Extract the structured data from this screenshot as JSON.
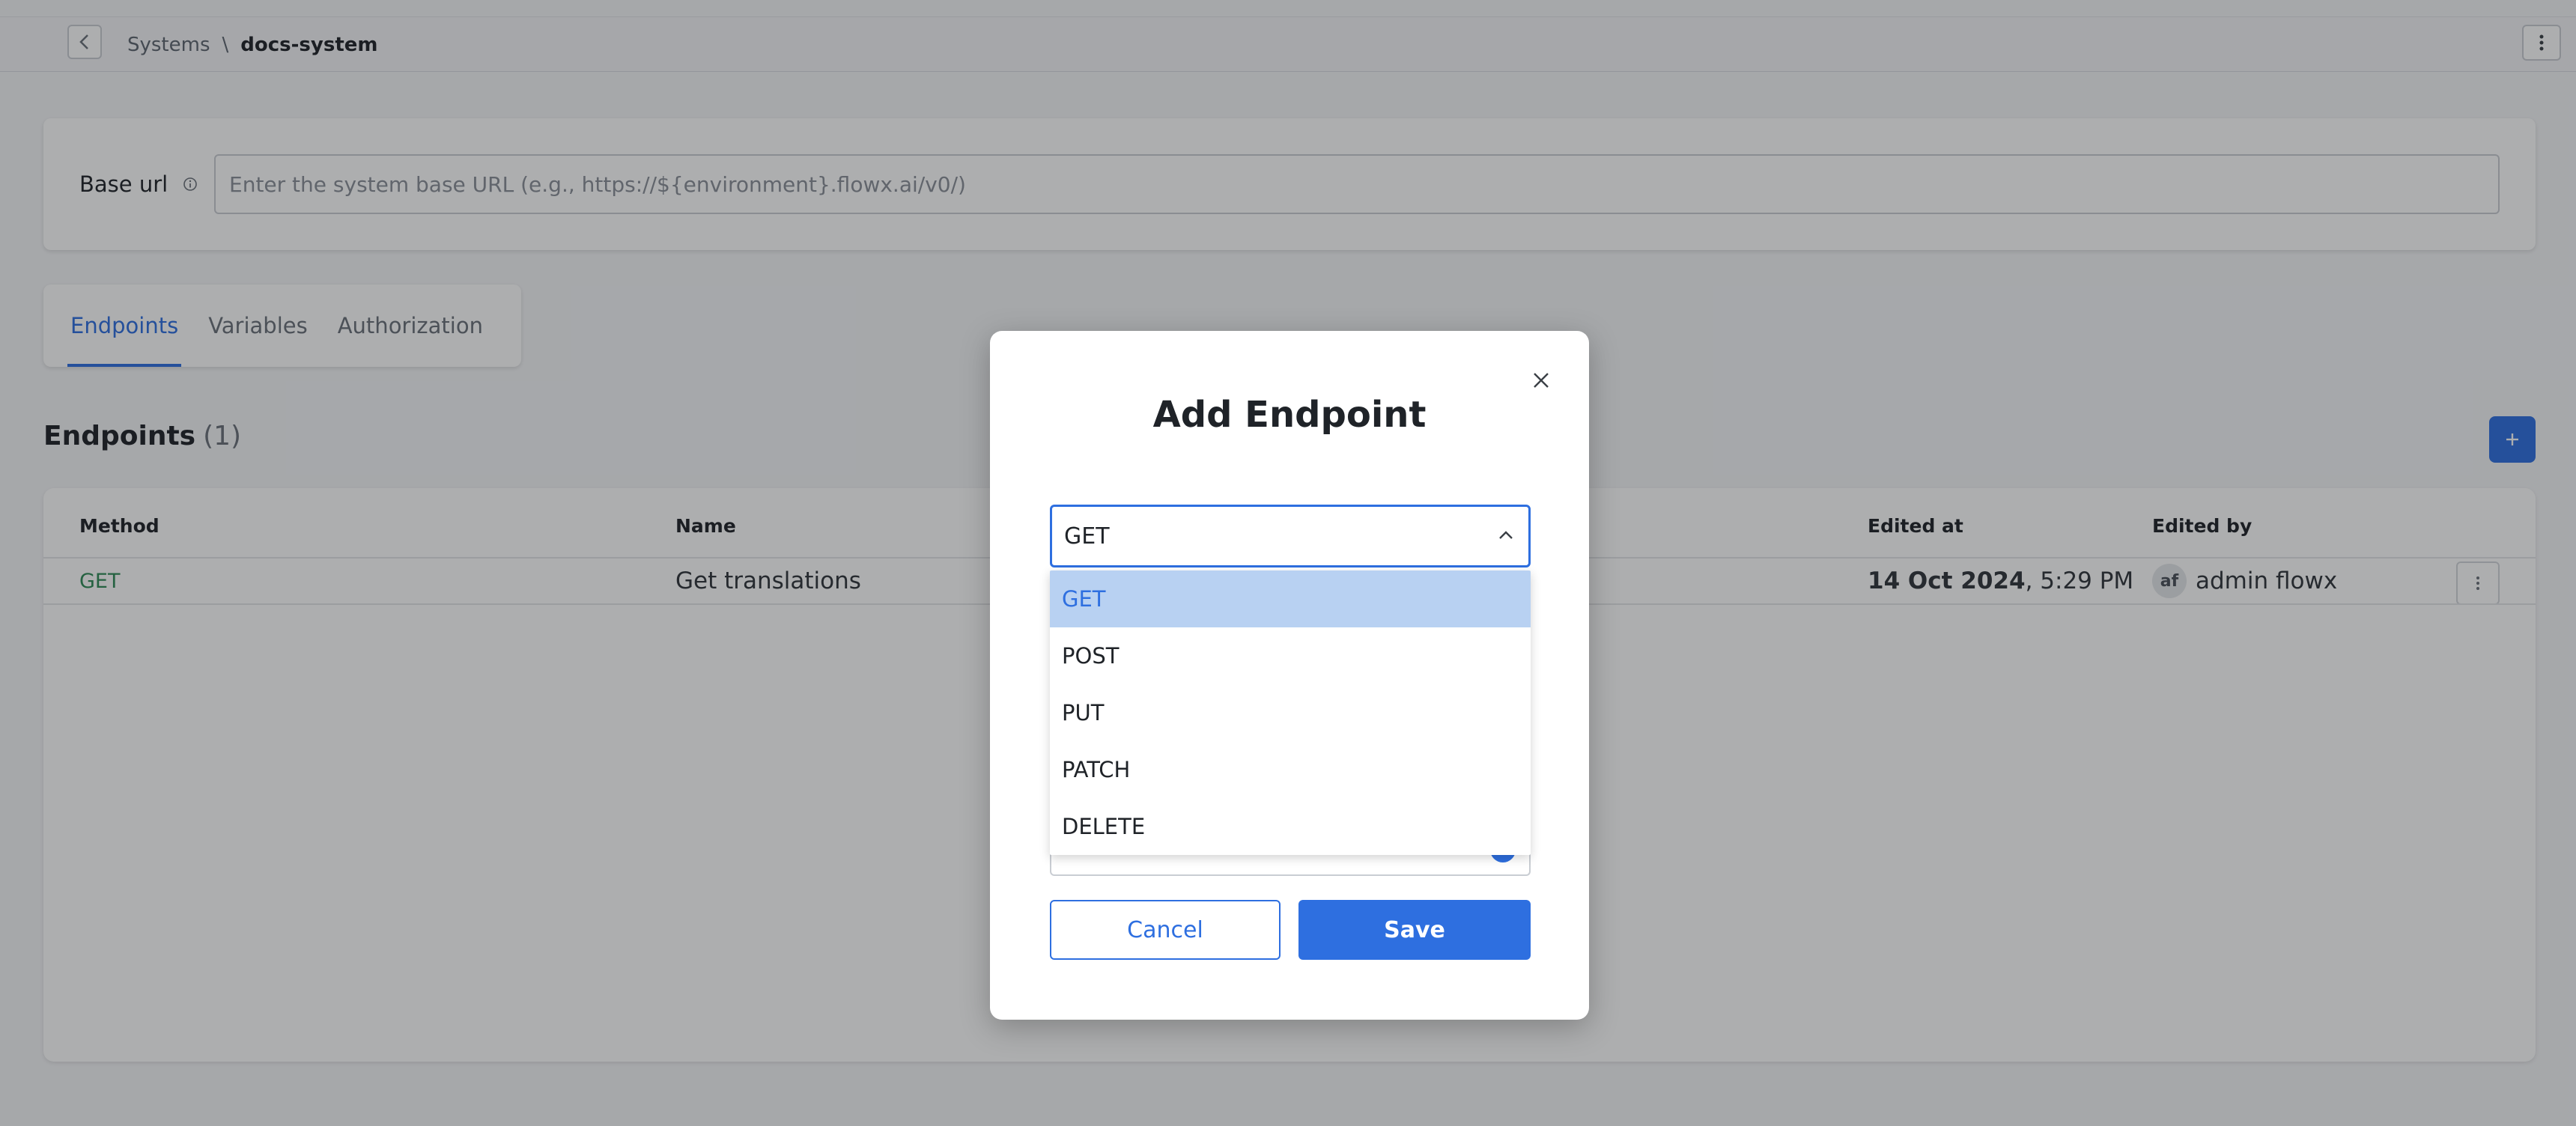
{
  "topbar": {
    "breadcrumb": {
      "parent": "Systems",
      "separator": "\\",
      "current": "docs-system"
    }
  },
  "base_url": {
    "label": "Base url",
    "value": "",
    "placeholder": "Enter the system base URL (e.g., https://${environment}.flowx.ai/v0/)"
  },
  "tabs": [
    {
      "label": "Endpoints",
      "active": true
    },
    {
      "label": "Variables",
      "active": false
    },
    {
      "label": "Authorization",
      "active": false
    }
  ],
  "endpoints": {
    "title": "Endpoints",
    "count": "(1)",
    "add_label": "+",
    "columns": {
      "method": "Method",
      "name": "Name",
      "edited_at": "Edited at",
      "edited_by": "Edited by"
    },
    "rows": [
      {
        "method": "GET",
        "name": "Get translations",
        "edited_date": "14 Oct 2024",
        "edited_time": ", 5:29 PM",
        "avatar_initials": "af",
        "edited_by": "admin flowx"
      }
    ]
  },
  "modal": {
    "title": "Add Endpoint",
    "select_value": "GET",
    "options": [
      {
        "label": "GET",
        "selected": true
      },
      {
        "label": "POST",
        "selected": false
      },
      {
        "label": "PUT",
        "selected": false
      },
      {
        "label": "PATCH",
        "selected": false
      },
      {
        "label": "DELETE",
        "selected": false
      }
    ],
    "cancel_label": "Cancel",
    "save_label": "Save"
  },
  "colors": {
    "accent": "#2e6fe0",
    "method_get": "#2e8a57",
    "option_selected_bg": "#b8d1f2"
  },
  "icons": {
    "back": "chevron-left-icon",
    "kebab": "kebab-menu-icon",
    "info": "info-icon",
    "close": "close-icon",
    "select": "chevron-up-icon"
  }
}
